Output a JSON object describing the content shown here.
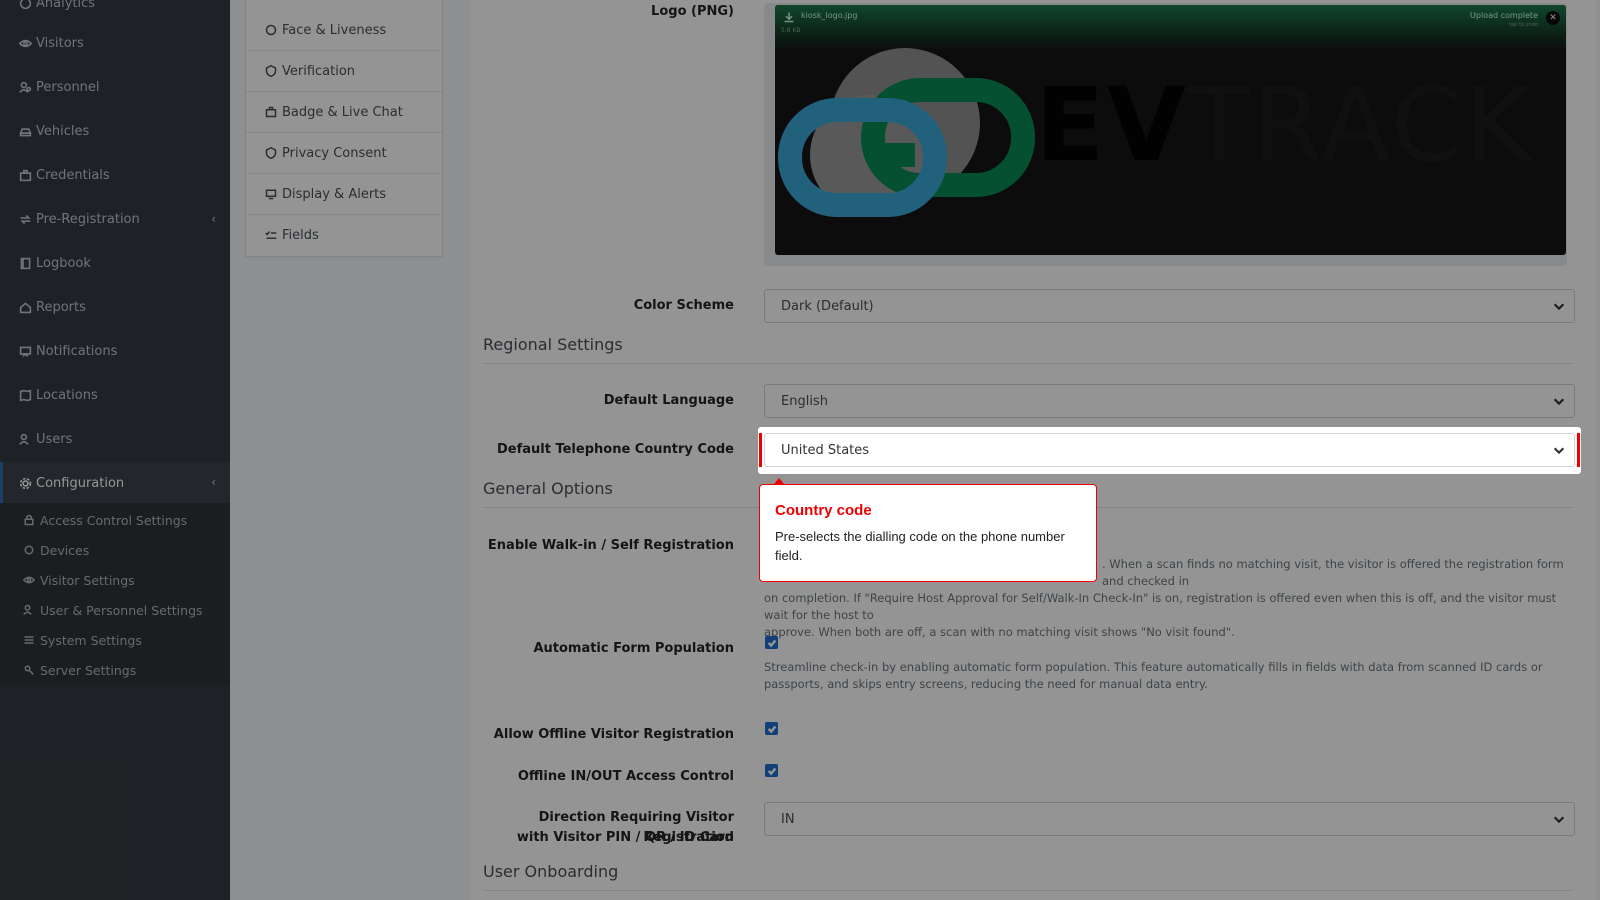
{
  "sidebar": {
    "items": [
      {
        "label": "Analytics",
        "icon": "chart-icon"
      },
      {
        "label": "Visitors",
        "icon": "eye-icon"
      },
      {
        "label": "Personnel",
        "icon": "user-gear-icon"
      },
      {
        "label": "Vehicles",
        "icon": "car-icon"
      },
      {
        "label": "Credentials",
        "icon": "id-card-icon"
      },
      {
        "label": "Pre-Registration",
        "icon": "arrows-icon"
      },
      {
        "label": "Logbook",
        "icon": "book-icon"
      },
      {
        "label": "Reports",
        "icon": "reports-icon"
      },
      {
        "label": "Notifications",
        "icon": "bell-icon"
      },
      {
        "label": "Locations",
        "icon": "map-icon"
      },
      {
        "label": "Users",
        "icon": "users-icon"
      },
      {
        "label": "Configuration",
        "icon": "gear-icon"
      }
    ],
    "sub_items": [
      {
        "label": "Access Control Settings",
        "icon": "lock-icon"
      },
      {
        "label": "Devices",
        "icon": "chip-icon"
      },
      {
        "label": "Visitor Settings",
        "icon": "eye-icon"
      },
      {
        "label": "User & Personnel Settings",
        "icon": "user-gear-icon"
      },
      {
        "label": "System Settings",
        "icon": "sliders-icon"
      },
      {
        "label": "Server Settings",
        "icon": "server-icon"
      }
    ]
  },
  "subnav": {
    "items": [
      {
        "label": "Face & Liveness",
        "icon": "face-icon"
      },
      {
        "label": "Verification",
        "icon": "shield-check-icon"
      },
      {
        "label": "Badge & Live Chat",
        "icon": "badge-icon"
      },
      {
        "label": "Privacy Consent",
        "icon": "shield-icon"
      },
      {
        "label": "Display & Alerts",
        "icon": "display-icon"
      },
      {
        "label": "Fields",
        "icon": "list-check-icon"
      }
    ]
  },
  "form": {
    "logo_label": "Logo (PNG)",
    "logo_file": "kiosk_logo.jpg",
    "logo_size": "5.8 KB",
    "upload_status": "Upload complete",
    "upload_sub": "tap to undo",
    "brand_bold": "EV",
    "brand_light": "TRACK",
    "color_scheme_label": "Color Scheme",
    "color_scheme_value": "Dark (Default)",
    "regional_heading": "Regional Settings",
    "language_label": "Default Language",
    "language_value": "English",
    "country_code_label": "Default Telephone Country Code",
    "country_code_value": "United States",
    "general_heading": "General Options",
    "walkin_label": "Enable Walk-in / Self Registration",
    "walkin_help_1": ". When a scan finds no matching visit, the visitor is offered the registration form and checked in",
    "walkin_help_2": "on completion. If \"Require Host Approval for Self/Walk-In Check-In\" is on, registration is offered even when this is off, and the visitor must wait for the host to",
    "walkin_help_3": "approve. When both are off, a scan with no matching visit shows \"No visit found\".",
    "auto_form_label": "Automatic Form Population",
    "auto_form_help": "Streamline check-in by enabling automatic form population. This feature automatically fills in fields with data from scanned ID cards or passports, and skips entry screens, reducing the need for manual data entry.",
    "offline_reg_label": "Allow Offline Visitor Registration",
    "offline_io_label": "Offline IN/OUT Access Control",
    "direction_label_1": "Direction Requiring Visitor Registration",
    "direction_label_2": "with Visitor PIN / QR / ID Card",
    "direction_value": "IN",
    "onboarding_heading": "User Onboarding"
  },
  "tooltip": {
    "title": "Country code",
    "body": "Pre-selects the dialling code on the phone number field."
  },
  "colors": {
    "sidebar_bg": "#343a40",
    "accent_red": "#ee0000",
    "checkbox_blue": "#1e6fd1",
    "brand_green": "#0a8a55",
    "brand_blue": "#3aa7d6"
  }
}
